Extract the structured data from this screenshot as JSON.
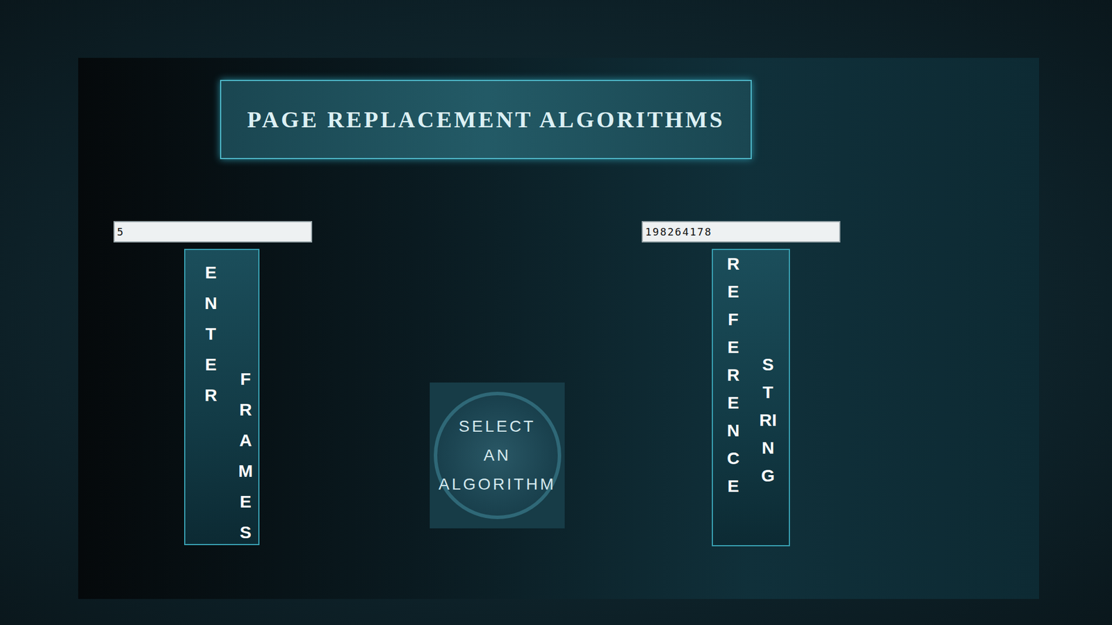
{
  "title": "PAGE REPLACEMENT ALGORITHMS",
  "frames": {
    "value": "5",
    "label": [
      "ENTER",
      "FRAMES"
    ]
  },
  "reference": {
    "value": "198264178",
    "label": [
      "REFERENCE",
      "STRING"
    ]
  },
  "button": {
    "lines": [
      "SELECT",
      "AN",
      "ALGORITHM"
    ]
  }
}
